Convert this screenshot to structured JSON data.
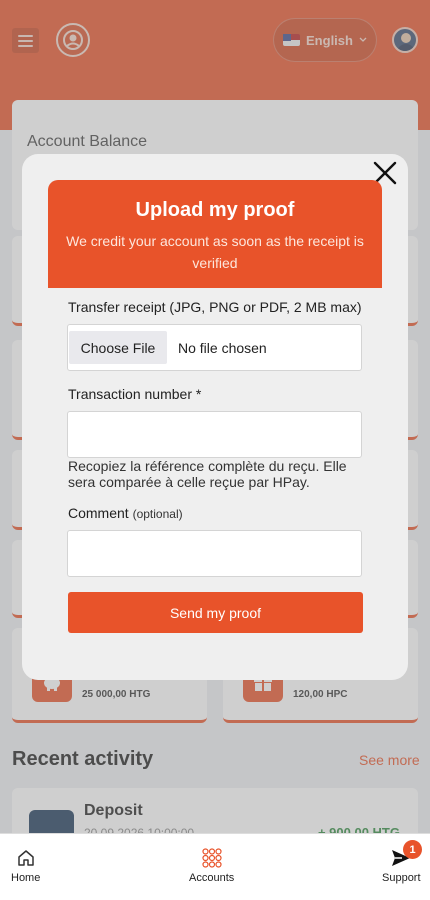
{
  "header": {
    "language_label": "English",
    "menu_icon": "hamburger-icon",
    "logo_icon": "brand-logo-icon",
    "avatar_icon": "user-avatar-icon"
  },
  "balance": {
    "title": "Account Balance"
  },
  "tiles": {
    "savings_amount": "25 000,00 HTG",
    "points_amount": "120,00 HPC"
  },
  "recent": {
    "title": "Recent activity",
    "see_more": "See more",
    "items": [
      {
        "title": "Deposit",
        "date": "20.09.2026 10:00:00",
        "amount": "+ 900,00 HTG"
      }
    ]
  },
  "modal": {
    "title": "Upload my proof",
    "subtitle": "We credit your account as soon as the receipt is verified",
    "receipt_label": "Transfer receipt (JPG, PNG or PDF, 2 MB max)",
    "choose_file": "Choose File",
    "no_file": "No file chosen",
    "transaction_label": "Transaction number",
    "required_mark": "*",
    "transaction_value": "",
    "transaction_help": "Recopiez la référence complète du reçu. Elle sera comparée à celle reçue par HPay.",
    "comment_label": "Comment",
    "comment_optional": "(optional)",
    "comment_value": "",
    "submit": "Send my proof"
  },
  "nav": {
    "home": "Home",
    "accounts": "Accounts",
    "support": "Support",
    "support_badge": "1"
  },
  "colors": {
    "accent": "#e8532a",
    "positive": "#2e8b3e"
  }
}
